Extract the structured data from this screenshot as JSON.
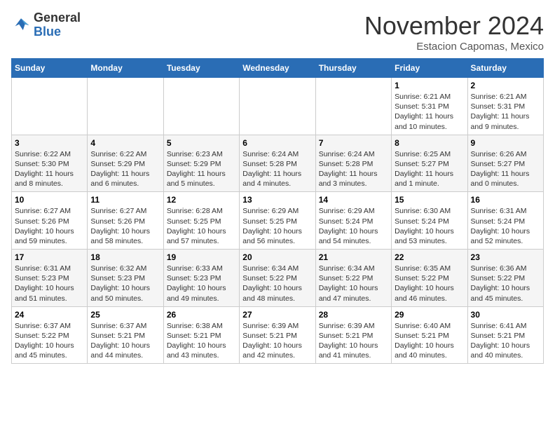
{
  "header": {
    "logo_general": "General",
    "logo_blue": "Blue",
    "month_title": "November 2024",
    "subtitle": "Estacion Capomas, Mexico"
  },
  "columns": [
    "Sunday",
    "Monday",
    "Tuesday",
    "Wednesday",
    "Thursday",
    "Friday",
    "Saturday"
  ],
  "weeks": [
    [
      {
        "day": "",
        "info": ""
      },
      {
        "day": "",
        "info": ""
      },
      {
        "day": "",
        "info": ""
      },
      {
        "day": "",
        "info": ""
      },
      {
        "day": "",
        "info": ""
      },
      {
        "day": "1",
        "info": "Sunrise: 6:21 AM\nSunset: 5:31 PM\nDaylight: 11 hours and 10 minutes."
      },
      {
        "day": "2",
        "info": "Sunrise: 6:21 AM\nSunset: 5:31 PM\nDaylight: 11 hours and 9 minutes."
      }
    ],
    [
      {
        "day": "3",
        "info": "Sunrise: 6:22 AM\nSunset: 5:30 PM\nDaylight: 11 hours and 8 minutes."
      },
      {
        "day": "4",
        "info": "Sunrise: 6:22 AM\nSunset: 5:29 PM\nDaylight: 11 hours and 6 minutes."
      },
      {
        "day": "5",
        "info": "Sunrise: 6:23 AM\nSunset: 5:29 PM\nDaylight: 11 hours and 5 minutes."
      },
      {
        "day": "6",
        "info": "Sunrise: 6:24 AM\nSunset: 5:28 PM\nDaylight: 11 hours and 4 minutes."
      },
      {
        "day": "7",
        "info": "Sunrise: 6:24 AM\nSunset: 5:28 PM\nDaylight: 11 hours and 3 minutes."
      },
      {
        "day": "8",
        "info": "Sunrise: 6:25 AM\nSunset: 5:27 PM\nDaylight: 11 hours and 1 minute."
      },
      {
        "day": "9",
        "info": "Sunrise: 6:26 AM\nSunset: 5:27 PM\nDaylight: 11 hours and 0 minutes."
      }
    ],
    [
      {
        "day": "10",
        "info": "Sunrise: 6:27 AM\nSunset: 5:26 PM\nDaylight: 10 hours and 59 minutes."
      },
      {
        "day": "11",
        "info": "Sunrise: 6:27 AM\nSunset: 5:26 PM\nDaylight: 10 hours and 58 minutes."
      },
      {
        "day": "12",
        "info": "Sunrise: 6:28 AM\nSunset: 5:25 PM\nDaylight: 10 hours and 57 minutes."
      },
      {
        "day": "13",
        "info": "Sunrise: 6:29 AM\nSunset: 5:25 PM\nDaylight: 10 hours and 56 minutes."
      },
      {
        "day": "14",
        "info": "Sunrise: 6:29 AM\nSunset: 5:24 PM\nDaylight: 10 hours and 54 minutes."
      },
      {
        "day": "15",
        "info": "Sunrise: 6:30 AM\nSunset: 5:24 PM\nDaylight: 10 hours and 53 minutes."
      },
      {
        "day": "16",
        "info": "Sunrise: 6:31 AM\nSunset: 5:24 PM\nDaylight: 10 hours and 52 minutes."
      }
    ],
    [
      {
        "day": "17",
        "info": "Sunrise: 6:31 AM\nSunset: 5:23 PM\nDaylight: 10 hours and 51 minutes."
      },
      {
        "day": "18",
        "info": "Sunrise: 6:32 AM\nSunset: 5:23 PM\nDaylight: 10 hours and 50 minutes."
      },
      {
        "day": "19",
        "info": "Sunrise: 6:33 AM\nSunset: 5:23 PM\nDaylight: 10 hours and 49 minutes."
      },
      {
        "day": "20",
        "info": "Sunrise: 6:34 AM\nSunset: 5:22 PM\nDaylight: 10 hours and 48 minutes."
      },
      {
        "day": "21",
        "info": "Sunrise: 6:34 AM\nSunset: 5:22 PM\nDaylight: 10 hours and 47 minutes."
      },
      {
        "day": "22",
        "info": "Sunrise: 6:35 AM\nSunset: 5:22 PM\nDaylight: 10 hours and 46 minutes."
      },
      {
        "day": "23",
        "info": "Sunrise: 6:36 AM\nSunset: 5:22 PM\nDaylight: 10 hours and 45 minutes."
      }
    ],
    [
      {
        "day": "24",
        "info": "Sunrise: 6:37 AM\nSunset: 5:22 PM\nDaylight: 10 hours and 45 minutes."
      },
      {
        "day": "25",
        "info": "Sunrise: 6:37 AM\nSunset: 5:21 PM\nDaylight: 10 hours and 44 minutes."
      },
      {
        "day": "26",
        "info": "Sunrise: 6:38 AM\nSunset: 5:21 PM\nDaylight: 10 hours and 43 minutes."
      },
      {
        "day": "27",
        "info": "Sunrise: 6:39 AM\nSunset: 5:21 PM\nDaylight: 10 hours and 42 minutes."
      },
      {
        "day": "28",
        "info": "Sunrise: 6:39 AM\nSunset: 5:21 PM\nDaylight: 10 hours and 41 minutes."
      },
      {
        "day": "29",
        "info": "Sunrise: 6:40 AM\nSunset: 5:21 PM\nDaylight: 10 hours and 40 minutes."
      },
      {
        "day": "30",
        "info": "Sunrise: 6:41 AM\nSunset: 5:21 PM\nDaylight: 10 hours and 40 minutes."
      }
    ]
  ]
}
